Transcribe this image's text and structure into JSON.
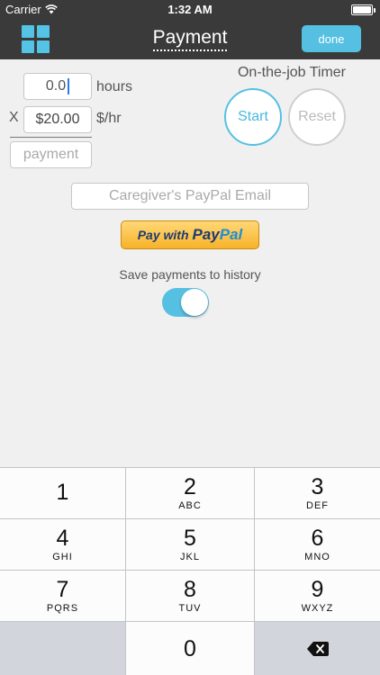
{
  "status_bar": {
    "carrier": "Carrier",
    "time": "1:32 AM"
  },
  "nav": {
    "title": "Payment",
    "done_label": "done"
  },
  "calculator": {
    "hours_value": "0.0",
    "hours_unit": "hours",
    "multiply_sign": "X",
    "rate_value": "$20.00",
    "rate_unit": "$/hr",
    "payment_placeholder": "payment"
  },
  "timer": {
    "label": "On-the-job Timer",
    "start_label": "Start",
    "reset_label": "Reset"
  },
  "paypal": {
    "email_placeholder": "Caregiver's PayPal Email",
    "button_with": "Pay with",
    "button_pay": "Pay",
    "button_pal": "Pal"
  },
  "history": {
    "label": "Save payments to history",
    "enabled": true
  },
  "keypad": {
    "keys": [
      {
        "num": "1",
        "letters": ""
      },
      {
        "num": "2",
        "letters": "ABC"
      },
      {
        "num": "3",
        "letters": "DEF"
      },
      {
        "num": "4",
        "letters": "GHI"
      },
      {
        "num": "5",
        "letters": "JKL"
      },
      {
        "num": "6",
        "letters": "MNO"
      },
      {
        "num": "7",
        "letters": "PQRS"
      },
      {
        "num": "8",
        "letters": "TUV"
      },
      {
        "num": "9",
        "letters": "WXYZ"
      },
      {
        "num": "0",
        "letters": ""
      }
    ]
  },
  "colors": {
    "accent": "#55c0e2",
    "nav_bg": "#3a3a3a",
    "background": "#f0f0f0"
  }
}
